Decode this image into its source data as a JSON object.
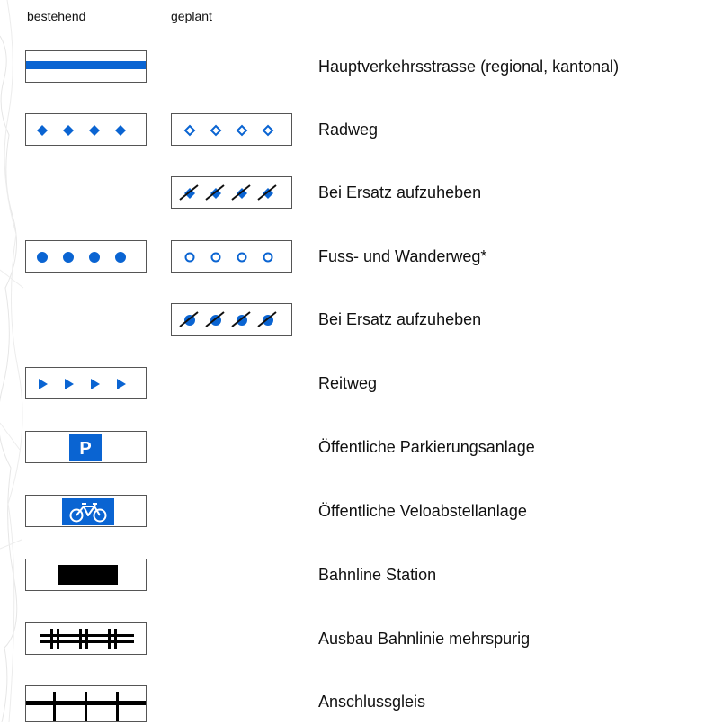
{
  "headers": {
    "existing": "bestehend",
    "planned": "geplant"
  },
  "colors": {
    "accent_blue": "#0a64d2",
    "rail_black": "#000000",
    "border": "#555555"
  },
  "legend": [
    {
      "label": "Hauptverkehrsstrasse (regional, kantonal)",
      "existing_symbol": "blue-band-line",
      "planned_symbol": null
    },
    {
      "label": "Radweg",
      "existing_symbol": "filled-diamonds",
      "planned_symbol": "outlined-diamonds"
    },
    {
      "label": "Bei Ersatz aufzuheben",
      "existing_symbol": null,
      "planned_symbol": "crossed-diamonds"
    },
    {
      "label": "Fuss- und Wanderweg*",
      "existing_symbol": "filled-circles",
      "planned_symbol": "outlined-circles"
    },
    {
      "label": "Bei Ersatz aufzuheben",
      "existing_symbol": null,
      "planned_symbol": "crossed-circles"
    },
    {
      "label": "Reitweg",
      "existing_symbol": "triangles-right",
      "planned_symbol": null
    },
    {
      "label": "Öffentliche Parkierungsanlage",
      "existing_symbol": "parking-sign",
      "planned_symbol": null
    },
    {
      "label": "Öffentliche Veloabstellanlage",
      "existing_symbol": "bicycle-sign",
      "planned_symbol": null
    },
    {
      "label": "Bahnline Station",
      "existing_symbol": "black-bar",
      "planned_symbol": null
    },
    {
      "label": "Ausbau Bahnlinie mehrspurig",
      "existing_symbol": "double-track-ticks",
      "planned_symbol": null
    },
    {
      "label": "Anschlussgleis",
      "existing_symbol": "siding-ticks",
      "planned_symbol": null
    }
  ],
  "signs": {
    "parking_letter": "P"
  }
}
